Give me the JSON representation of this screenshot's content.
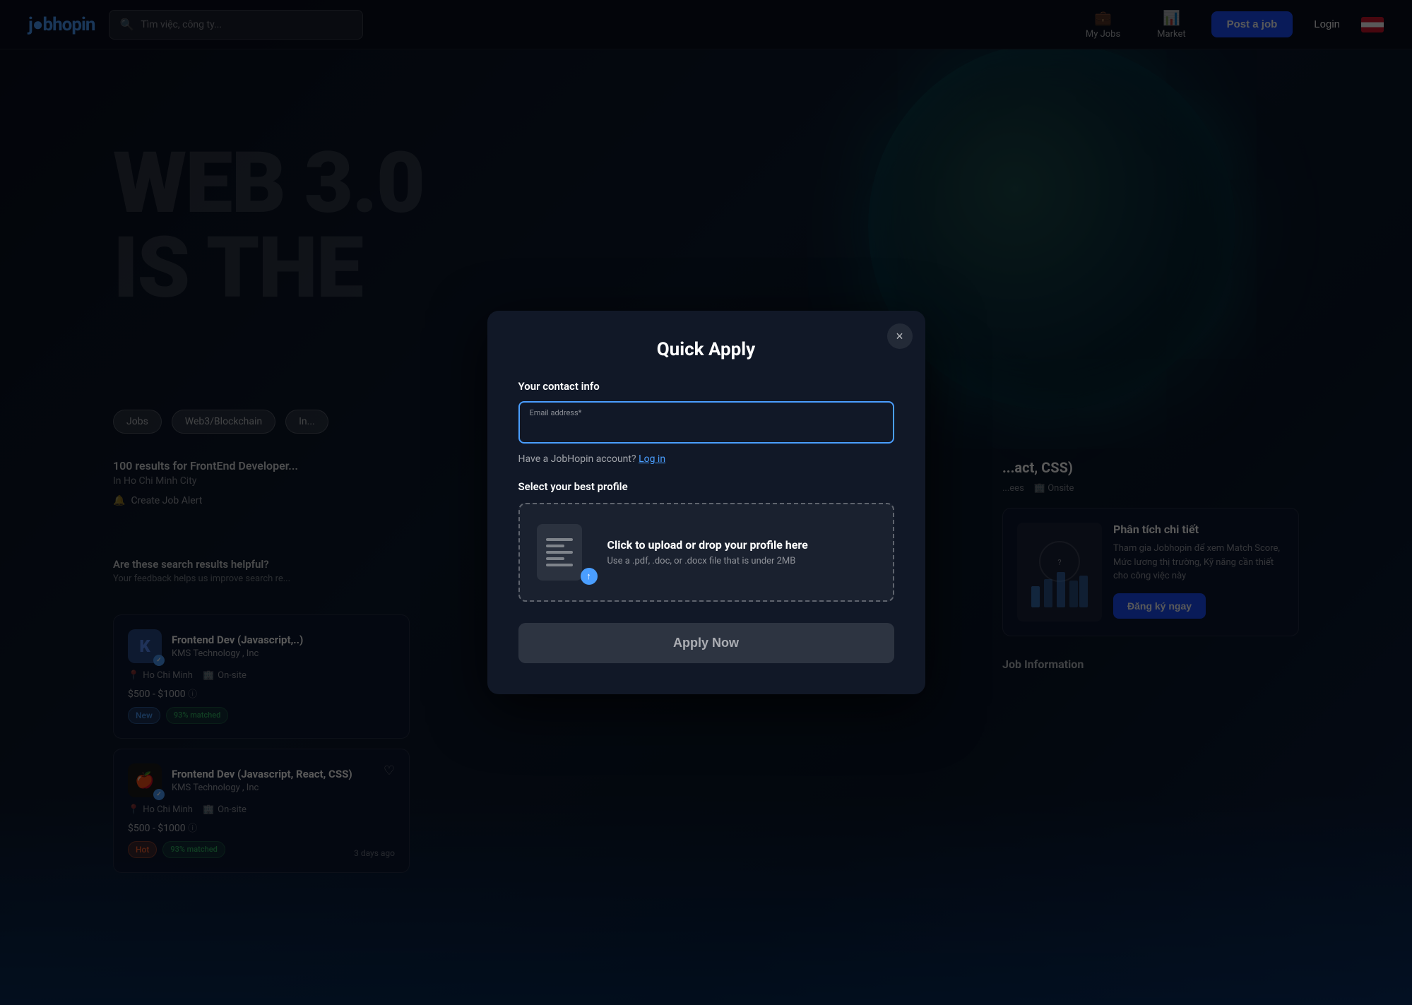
{
  "site": {
    "logo_text": "j●bhopin",
    "logo_dot_color": "#4a9eff"
  },
  "navbar": {
    "search_placeholder": "Tìm việc, công ty...",
    "my_jobs_label": "My Jobs",
    "market_label": "Market",
    "post_job_label": "Post a job",
    "login_label": "Login"
  },
  "hero": {
    "line1": "WEB 3.0",
    "line2": "IS THE"
  },
  "filters": {
    "chips": [
      "Jobs",
      "Web3/Blockchain",
      "In..."
    ]
  },
  "results": {
    "count_text": "100 results for FrontEnd Developer...",
    "location_text": "In Ho Chi Minh City",
    "create_alert_text": "Create Job Alert"
  },
  "feedback": {
    "title": "Are these search results helpful?",
    "subtitle": "Your feedback helps us improve search re..."
  },
  "job_cards": [
    {
      "title": "Frontend Dev (Javascript,..)",
      "company": "KMS Technology , Inc",
      "location": "Ho Chi Minh",
      "work_type": "On-site",
      "salary": "$500 - $1000",
      "badges": [
        "New",
        "93% matched"
      ],
      "logo_text": "K",
      "logo_style": "kms"
    },
    {
      "title": "Frontend Dev (Javascript, React, CSS)",
      "company": "KMS Technology , Inc",
      "location": "Ho Chi Minh",
      "work_type": "On-site",
      "salary": "$500 - $1000",
      "badges": [
        "Hot",
        "93% matched"
      ],
      "days_ago": "3 days ago",
      "logo_text": "🍎",
      "logo_style": "apple"
    }
  ],
  "right_panel": {
    "job_title": "...act, CSS)",
    "job_meta": [
      "...ees",
      "Onsite"
    ],
    "analysis_title": "Phân tích chi tiết",
    "analysis_desc": "Tham gia Jobhopin để xem Match Score, Mức lương thị trường, Kỹ năng cần thiết cho công việc này",
    "register_label": "Đăng ký ngay",
    "job_info_label": "Job Information"
  },
  "modal": {
    "title": "Quick Apply",
    "contact_section_label": "Your contact info",
    "email_label": "Email address*",
    "email_placeholder": "",
    "login_prompt": "Have a JobHopin account?",
    "login_link_text": "Log in",
    "profile_section_label": "Select your best profile",
    "upload_main_text": "Click to upload or drop your profile here",
    "upload_sub_text": "Use a .pdf, .doc, or .docx file that is under 2MB",
    "apply_button_label": "Apply Now",
    "close_button_label": "×"
  }
}
